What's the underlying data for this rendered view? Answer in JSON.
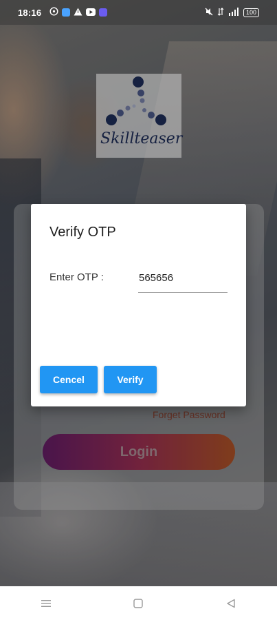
{
  "status_bar": {
    "time": "18:16",
    "battery": "100",
    "app_icons": [
      "whatsapp-icon",
      "app-icon",
      "alert-icon",
      "youtube-icon",
      "discord-icon"
    ],
    "system_icons": [
      "mute-icon",
      "data-icon",
      "signal-icon"
    ]
  },
  "logo": {
    "text": "Skillteaser"
  },
  "login": {
    "forget_password": "Forget Password",
    "login_button": "Login"
  },
  "dialog": {
    "title": "Verify OTP",
    "otp_label": "Enter OTP :",
    "otp_value": "565656",
    "cancel_label": "Cencel",
    "verify_label": "Verify"
  },
  "colors": {
    "accent": "#2196f3",
    "login_gradient_start": "#5a1a5c",
    "login_gradient_end": "#9b4a22",
    "forget_text": "#7a3a2a"
  },
  "nav": {
    "items": [
      "menu-icon",
      "home-icon",
      "back-icon"
    ]
  }
}
